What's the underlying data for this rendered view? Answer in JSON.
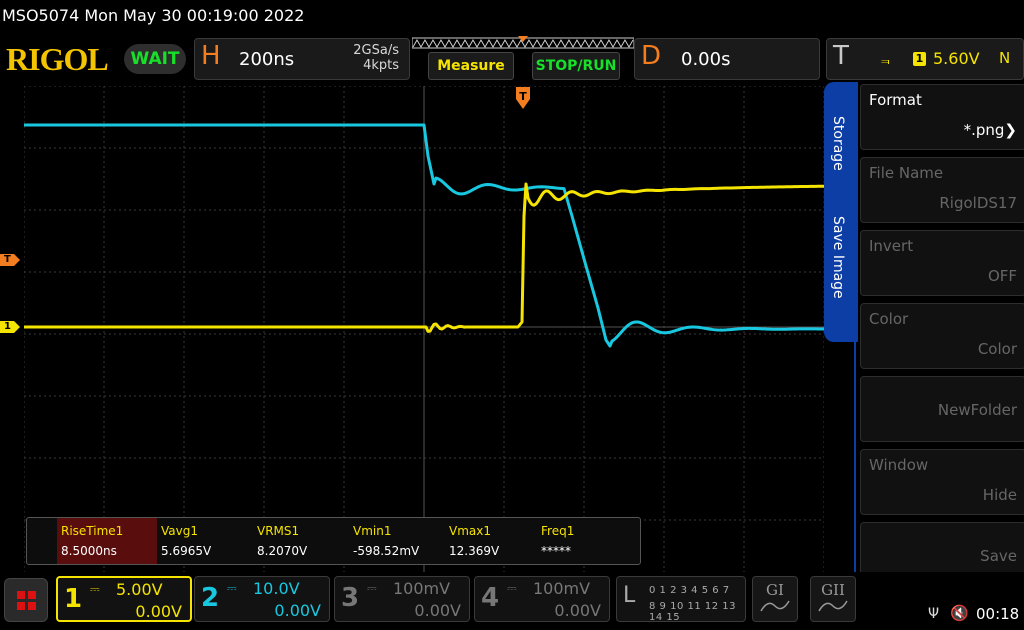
{
  "header": {
    "title": "MSO5074  Mon May 30 00:19:00 2022"
  },
  "toolbar": {
    "brand": "RIGOL",
    "status": "WAIT",
    "horizontal_letter": "H",
    "timebase": "200ns",
    "sample_rate": "2GSa/s",
    "memory_depth": "4kpts",
    "measure_label": "Measure",
    "stop_run_label": "STOP/RUN",
    "delay_letter": "D",
    "delay": "0.00s",
    "trigger_letter": "T",
    "trigger_source": "1",
    "trigger_level": "5.60V",
    "trigger_mode": "N",
    "trigger_edge_icon": "rising-edge-icon"
  },
  "markers": {
    "trigger_level": "T",
    "ch1": "1"
  },
  "measurements": [
    {
      "name": "RiseTime1",
      "value": "8.5000ns",
      "selected": true
    },
    {
      "name": "Vavg1",
      "value": "5.6965V"
    },
    {
      "name": "VRMS1",
      "value": "8.2070V"
    },
    {
      "name": "Vmin1",
      "value": "-598.52mV"
    },
    {
      "name": "Vmax1",
      "value": "12.369V"
    },
    {
      "name": "Freq1",
      "value": "*****"
    }
  ],
  "side_menu": {
    "tab_storage": "Storage",
    "tab_save_image": "Save Image",
    "items": [
      {
        "label": "Format",
        "value": "*.png",
        "active": true
      },
      {
        "label": "File Name",
        "value": "RigolDS17"
      },
      {
        "label": "Invert",
        "value": "OFF"
      },
      {
        "label": "Color",
        "value": "Color"
      },
      {
        "label": "",
        "value": "NewFolder"
      },
      {
        "label": "Window",
        "value": "Hide"
      },
      {
        "label": "",
        "value": "Save"
      }
    ]
  },
  "channels": [
    {
      "number": "1",
      "coupling": "⎓",
      "scale": "5.00V",
      "offset": "0.00V"
    },
    {
      "number": "2",
      "coupling": "⎓",
      "scale": "10.0V",
      "offset": "0.00V"
    },
    {
      "number": "3",
      "coupling": "⎓",
      "scale": "100mV",
      "offset": "0.00V"
    },
    {
      "number": "4",
      "coupling": "⎓",
      "scale": "100mV",
      "offset": "0.00V"
    }
  ],
  "logic": {
    "letter": "L",
    "row1": "0 1 2 3  4 5 6 7",
    "row2": "8 9 10 11  12 13 14 15"
  },
  "decoders": [
    "GI",
    "GII"
  ],
  "status_bar": {
    "time": "00:18"
  },
  "colors": {
    "ch1": "#f5e400",
    "ch2": "#18c8e0",
    "accent": "#f47d1f",
    "menu_blue": "#0d3ea6"
  }
}
